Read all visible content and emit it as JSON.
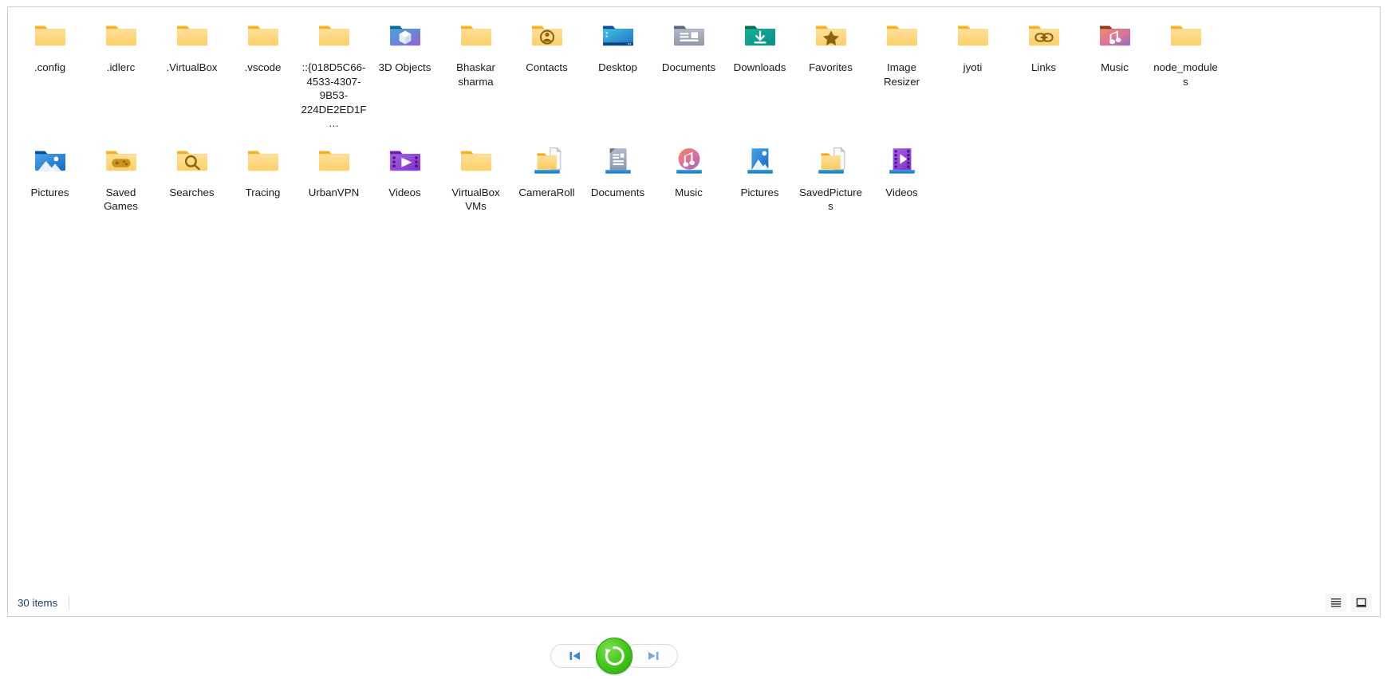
{
  "window": {
    "title": "File Explorer content pane"
  },
  "items": {
    "row1": [
      {
        "label": ".config",
        "icon": "folder-plain-icon"
      },
      {
        "label": ".idlerc",
        "icon": "folder-plain-icon"
      },
      {
        "label": ".VirtualBox",
        "icon": "folder-plain-icon"
      },
      {
        "label": ".vscode",
        "icon": "folder-plain-icon"
      },
      {
        "label": "::{018D5C66-4533-4307-9B53-224DE2ED1F…",
        "icon": "folder-plain-icon"
      },
      {
        "label": "3D Objects",
        "icon": "folder-3d-objects-icon"
      },
      {
        "label": "Bhaskar sharma",
        "icon": "folder-plain-icon"
      },
      {
        "label": "Contacts",
        "icon": "folder-contacts-icon"
      },
      {
        "label": "Desktop",
        "icon": "folder-desktop-icon"
      },
      {
        "label": "Documents",
        "icon": "folder-documents-icon"
      },
      {
        "label": "Downloads",
        "icon": "folder-downloads-icon"
      },
      {
        "label": "Favorites",
        "icon": "folder-favorites-icon"
      },
      {
        "label": "Image Resizer",
        "icon": "folder-plain-icon"
      },
      {
        "label": "jyoti",
        "icon": "folder-plain-icon"
      },
      {
        "label": "Links",
        "icon": "folder-links-icon"
      },
      {
        "label": "Music",
        "icon": "folder-music-icon"
      },
      {
        "label": "node_modules",
        "icon": "folder-plain-icon"
      }
    ],
    "row2": [
      {
        "label": "Pictures",
        "icon": "folder-pictures-icon"
      },
      {
        "label": "Saved Games",
        "icon": "folder-saved-games-icon"
      },
      {
        "label": "Searches",
        "icon": "folder-searches-icon"
      },
      {
        "label": "Tracing",
        "icon": "folder-plain-icon"
      },
      {
        "label": "UrbanVPN",
        "icon": "folder-plain-icon"
      },
      {
        "label": "Videos",
        "icon": "folder-videos-icon"
      },
      {
        "label": "VirtualBox VMs",
        "icon": "folder-plain-icon"
      },
      {
        "label": "CameraRoll",
        "icon": "library-generic-icon"
      },
      {
        "label": "Documents",
        "icon": "library-documents-icon"
      },
      {
        "label": "Music",
        "icon": "library-music-icon"
      },
      {
        "label": "Pictures",
        "icon": "library-pictures-icon"
      },
      {
        "label": "SavedPictures",
        "icon": "library-generic-icon"
      },
      {
        "label": "Videos",
        "icon": "library-videos-icon"
      }
    ]
  },
  "status_bar": {
    "item_count": "30 items",
    "details_view_label": "details-view",
    "large_icons_view_label": "large-icons-view"
  },
  "playback": {
    "previous_label": "previous",
    "replay_label": "replay",
    "next_label": "next"
  },
  "colors": {
    "folder_body": "#fcd779",
    "folder_tab": "#f5b324",
    "library_base": "#1e8fd5",
    "replay_green": "#46c81e",
    "panel_border": "#cfcfcf",
    "status_text": "#1d3f68"
  }
}
